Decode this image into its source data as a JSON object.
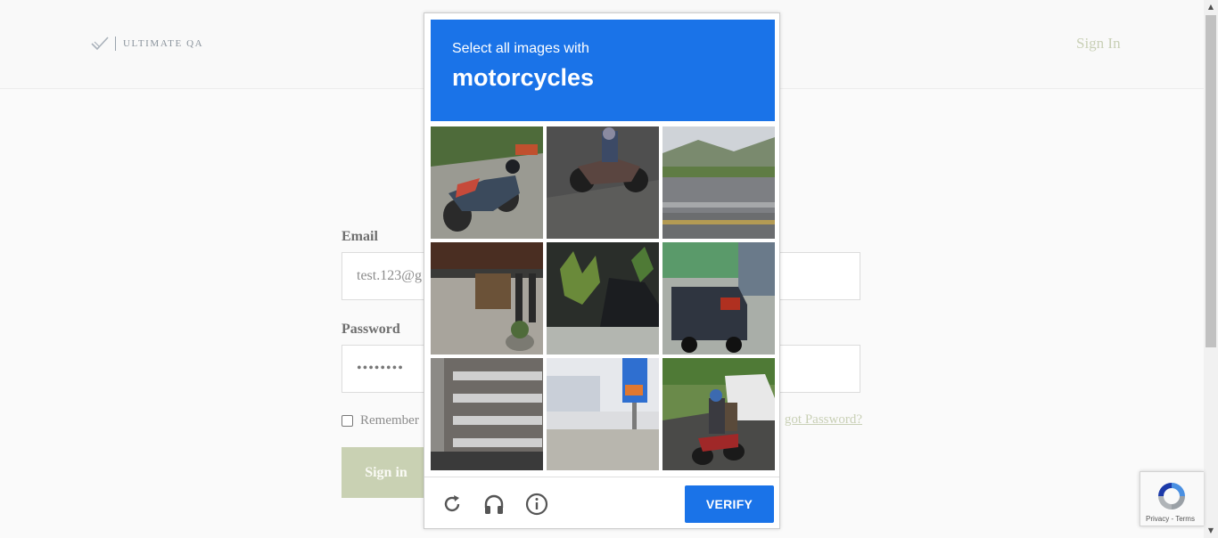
{
  "header": {
    "brand": "ULTIMATE QA",
    "signin_link": "Sign In"
  },
  "form": {
    "email_label": "Email",
    "email_value": "test.123@g",
    "password_label": "Password",
    "password_value": "••••••••",
    "remember_label": "Remember",
    "forgot_label": "got Password?",
    "signin_button": "Sign in"
  },
  "captcha": {
    "instruction": "Select all images with",
    "target": "motorcycles",
    "tiles": [
      {
        "name": "motorcycle-parked"
      },
      {
        "name": "motorcycle-rider"
      },
      {
        "name": "highway-road"
      },
      {
        "name": "sidewalk-bench"
      },
      {
        "name": "plants-car"
      },
      {
        "name": "van-street"
      },
      {
        "name": "apartment-building"
      },
      {
        "name": "gas-station"
      },
      {
        "name": "motorcycle-riders-road"
      }
    ],
    "reload_icon": "reload-icon",
    "audio_icon": "headphones-icon",
    "info_icon": "info-icon",
    "verify_label": "VERIFY"
  },
  "badge": {
    "text": "Privacy - Terms"
  },
  "colors": {
    "accent_blue": "#1a73e8",
    "brand_muted": "#c9d1b3"
  }
}
